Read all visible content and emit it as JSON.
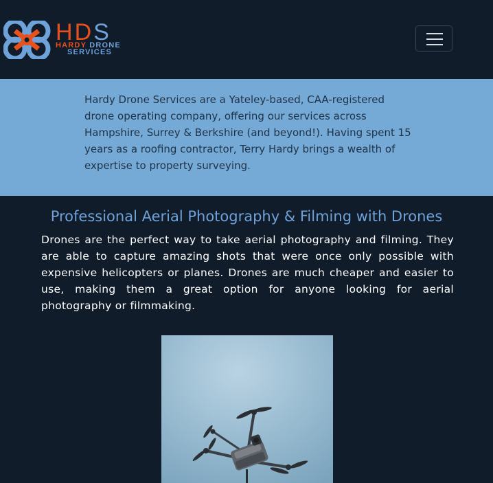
{
  "header": {
    "logo": {
      "letters_h": "H",
      "letters_d": "D",
      "letters_s": "S",
      "line1_hardy": "HARDY",
      "line1_drone": "DRONE",
      "line2": "SERVICES"
    },
    "menu_icon": "hamburger-icon"
  },
  "intro": {
    "text": "Hardy Drone Services are a Yateley-based, CAA-registered drone operating company, offering our services across Hampshire, Surrey & Berkshire (and beyond!). Having spent 15 years as a roofing contractor, Terry Hardy brings a wealth of expertise to property surveying."
  },
  "section": {
    "title": "Professional Aerial Photography & Filming with Drones",
    "body": "Drones are the perfect way to take aerial photography and filming. They are able to capture amazing shots that were once only possible with expensive helicopters or planes. Drones are much cheaper and easier to use, making them a great option for anyone looking for aerial photography or filmmaking."
  },
  "colors": {
    "background": "#111c2b",
    "intro_band": "#75a9d6",
    "accent_blue": "#6ea2d8",
    "accent_orange": "#e8511c"
  }
}
